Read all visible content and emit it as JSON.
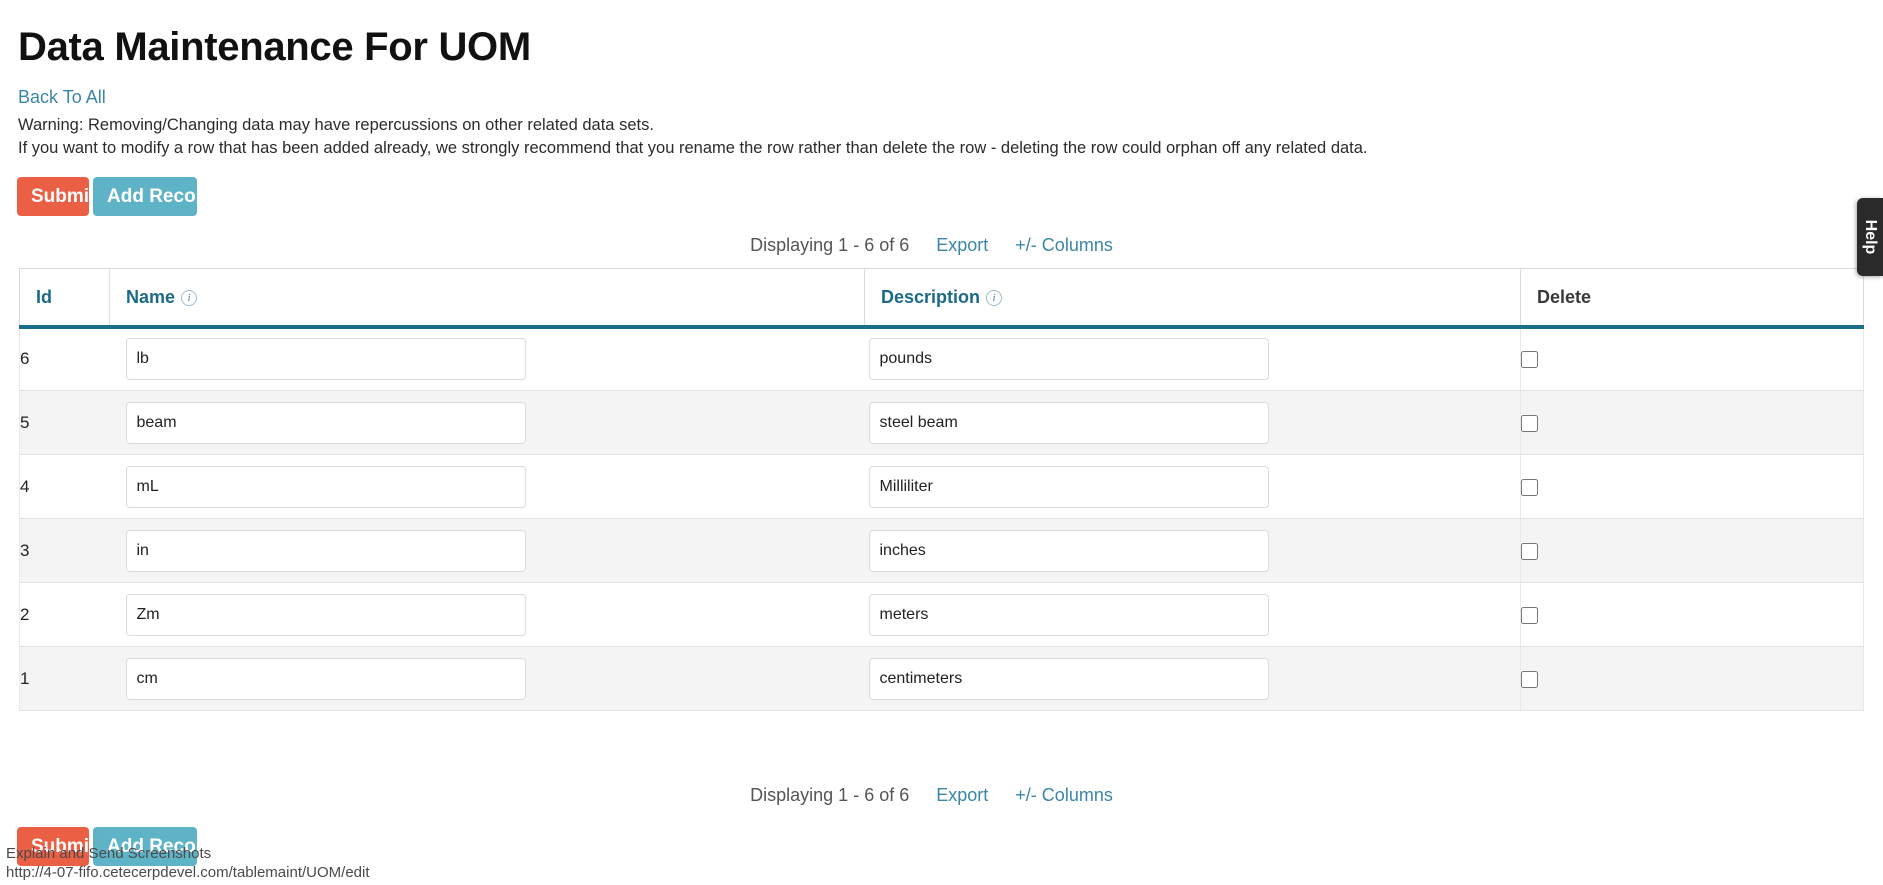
{
  "page": {
    "title": "Data Maintenance For UOM",
    "back_link": "Back To All",
    "warning_line_1": "Warning: Removing/Changing data may have repercussions on other related data sets.",
    "warning_line_2": "If you want to modify a row that has been added already, we strongly recommend that you rename the row rather than delete the row - deleting the row could orphan off any related data."
  },
  "actions": {
    "submit_label": "Submit",
    "add_record_label": "Add Record",
    "submit_color": "#eb5f45",
    "add_record_color": "#5fb3c7"
  },
  "table_meta": {
    "count_text": "Displaying 1 - 6 of 6",
    "export_label": "Export",
    "columns_label": "+/- Columns"
  },
  "table": {
    "headers": {
      "id": "Id",
      "name": "Name",
      "description": "Description",
      "delete": "Delete"
    },
    "info_icon": "info-icon",
    "accent_color": "#1c6c8c",
    "link_color": "#3b86a8",
    "rows": [
      {
        "id": "6",
        "name": "lb",
        "description": "pounds",
        "delete_checked": false
      },
      {
        "id": "5",
        "name": "beam",
        "description": "steel beam",
        "delete_checked": false
      },
      {
        "id": "4",
        "name": "mL",
        "description": "Milliliter",
        "delete_checked": false
      },
      {
        "id": "3",
        "name": "in",
        "description": "inches",
        "delete_checked": false
      },
      {
        "id": "2",
        "name": "Zm",
        "description": "meters",
        "delete_checked": false
      },
      {
        "id": "1",
        "name": "cm",
        "description": "centimeters",
        "delete_checked": false
      }
    ]
  },
  "help_tab": {
    "label": "Help"
  },
  "overlays": {
    "extension_tooltip": "Explain and Send Screenshots",
    "status_url": "http://4-07-fifo.cetecerpdevel.com/tablemaint/UOM/edit"
  }
}
